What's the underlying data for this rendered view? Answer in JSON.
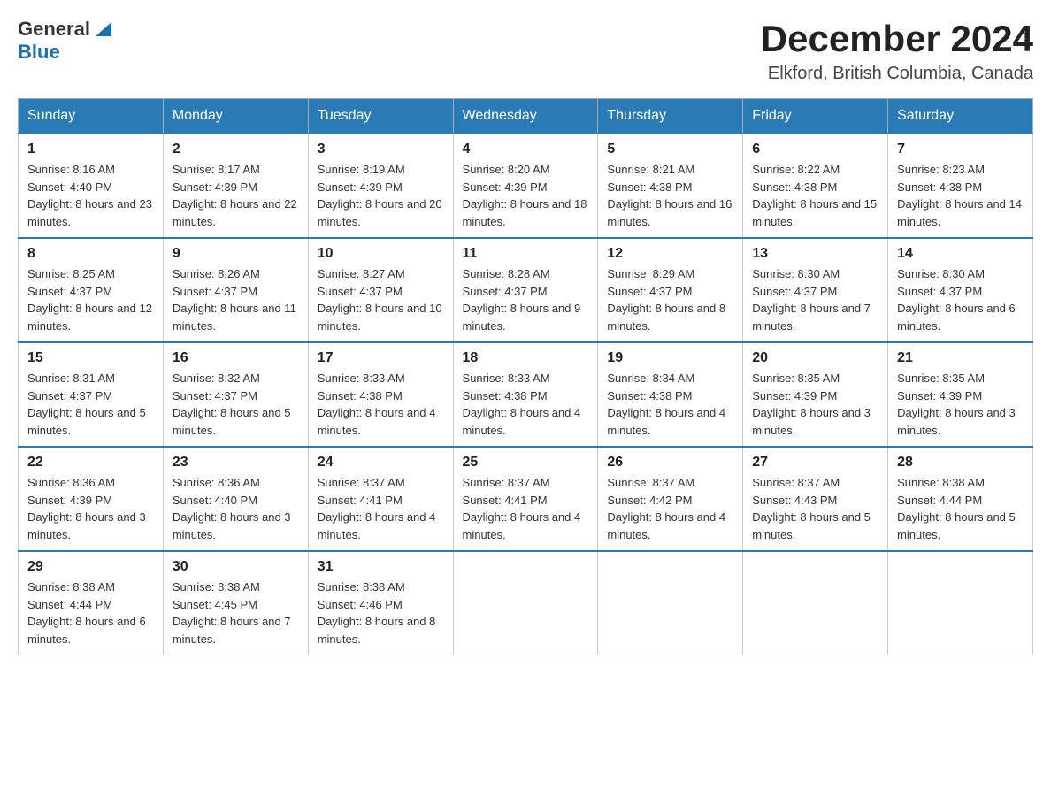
{
  "header": {
    "logo": {
      "general": "General",
      "blue": "Blue"
    },
    "title": "December 2024",
    "subtitle": "Elkford, British Columbia, Canada"
  },
  "calendar": {
    "days_of_week": [
      "Sunday",
      "Monday",
      "Tuesday",
      "Wednesday",
      "Thursday",
      "Friday",
      "Saturday"
    ],
    "weeks": [
      [
        {
          "day": "1",
          "sunrise": "8:16 AM",
          "sunset": "4:40 PM",
          "daylight": "8 hours and 23 minutes."
        },
        {
          "day": "2",
          "sunrise": "8:17 AM",
          "sunset": "4:39 PM",
          "daylight": "8 hours and 22 minutes."
        },
        {
          "day": "3",
          "sunrise": "8:19 AM",
          "sunset": "4:39 PM",
          "daylight": "8 hours and 20 minutes."
        },
        {
          "day": "4",
          "sunrise": "8:20 AM",
          "sunset": "4:39 PM",
          "daylight": "8 hours and 18 minutes."
        },
        {
          "day": "5",
          "sunrise": "8:21 AM",
          "sunset": "4:38 PM",
          "daylight": "8 hours and 16 minutes."
        },
        {
          "day": "6",
          "sunrise": "8:22 AM",
          "sunset": "4:38 PM",
          "daylight": "8 hours and 15 minutes."
        },
        {
          "day": "7",
          "sunrise": "8:23 AM",
          "sunset": "4:38 PM",
          "daylight": "8 hours and 14 minutes."
        }
      ],
      [
        {
          "day": "8",
          "sunrise": "8:25 AM",
          "sunset": "4:37 PM",
          "daylight": "8 hours and 12 minutes."
        },
        {
          "day": "9",
          "sunrise": "8:26 AM",
          "sunset": "4:37 PM",
          "daylight": "8 hours and 11 minutes."
        },
        {
          "day": "10",
          "sunrise": "8:27 AM",
          "sunset": "4:37 PM",
          "daylight": "8 hours and 10 minutes."
        },
        {
          "day": "11",
          "sunrise": "8:28 AM",
          "sunset": "4:37 PM",
          "daylight": "8 hours and 9 minutes."
        },
        {
          "day": "12",
          "sunrise": "8:29 AM",
          "sunset": "4:37 PM",
          "daylight": "8 hours and 8 minutes."
        },
        {
          "day": "13",
          "sunrise": "8:30 AM",
          "sunset": "4:37 PM",
          "daylight": "8 hours and 7 minutes."
        },
        {
          "day": "14",
          "sunrise": "8:30 AM",
          "sunset": "4:37 PM",
          "daylight": "8 hours and 6 minutes."
        }
      ],
      [
        {
          "day": "15",
          "sunrise": "8:31 AM",
          "sunset": "4:37 PM",
          "daylight": "8 hours and 5 minutes."
        },
        {
          "day": "16",
          "sunrise": "8:32 AM",
          "sunset": "4:37 PM",
          "daylight": "8 hours and 5 minutes."
        },
        {
          "day": "17",
          "sunrise": "8:33 AM",
          "sunset": "4:38 PM",
          "daylight": "8 hours and 4 minutes."
        },
        {
          "day": "18",
          "sunrise": "8:33 AM",
          "sunset": "4:38 PM",
          "daylight": "8 hours and 4 minutes."
        },
        {
          "day": "19",
          "sunrise": "8:34 AM",
          "sunset": "4:38 PM",
          "daylight": "8 hours and 4 minutes."
        },
        {
          "day": "20",
          "sunrise": "8:35 AM",
          "sunset": "4:39 PM",
          "daylight": "8 hours and 3 minutes."
        },
        {
          "day": "21",
          "sunrise": "8:35 AM",
          "sunset": "4:39 PM",
          "daylight": "8 hours and 3 minutes."
        }
      ],
      [
        {
          "day": "22",
          "sunrise": "8:36 AM",
          "sunset": "4:39 PM",
          "daylight": "8 hours and 3 minutes."
        },
        {
          "day": "23",
          "sunrise": "8:36 AM",
          "sunset": "4:40 PM",
          "daylight": "8 hours and 3 minutes."
        },
        {
          "day": "24",
          "sunrise": "8:37 AM",
          "sunset": "4:41 PM",
          "daylight": "8 hours and 4 minutes."
        },
        {
          "day": "25",
          "sunrise": "8:37 AM",
          "sunset": "4:41 PM",
          "daylight": "8 hours and 4 minutes."
        },
        {
          "day": "26",
          "sunrise": "8:37 AM",
          "sunset": "4:42 PM",
          "daylight": "8 hours and 4 minutes."
        },
        {
          "day": "27",
          "sunrise": "8:37 AM",
          "sunset": "4:43 PM",
          "daylight": "8 hours and 5 minutes."
        },
        {
          "day": "28",
          "sunrise": "8:38 AM",
          "sunset": "4:44 PM",
          "daylight": "8 hours and 5 minutes."
        }
      ],
      [
        {
          "day": "29",
          "sunrise": "8:38 AM",
          "sunset": "4:44 PM",
          "daylight": "8 hours and 6 minutes."
        },
        {
          "day": "30",
          "sunrise": "8:38 AM",
          "sunset": "4:45 PM",
          "daylight": "8 hours and 7 minutes."
        },
        {
          "day": "31",
          "sunrise": "8:38 AM",
          "sunset": "4:46 PM",
          "daylight": "8 hours and 8 minutes."
        },
        null,
        null,
        null,
        null
      ]
    ]
  }
}
